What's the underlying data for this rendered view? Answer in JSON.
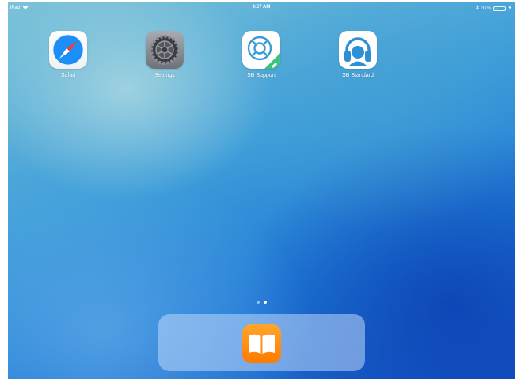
{
  "status_bar": {
    "device": "iPad",
    "time": "9:57 AM",
    "battery_text": "31%",
    "battery_level": 0.31,
    "wifi_icon": "wifi-icon",
    "bluetooth_icon": "bluetooth-icon",
    "charging_icon": "charging-bolt-icon"
  },
  "apps": [
    {
      "label": "Safari",
      "icon": "safari-compass-icon"
    },
    {
      "label": "Settings",
      "icon": "settings-gear-icon"
    },
    {
      "label": "SB Support",
      "icon": "lifebuoy-icon"
    },
    {
      "label": "SB Standard",
      "icon": "headphones-icon"
    }
  ],
  "page_indicator": {
    "pages": 2,
    "current": 2
  },
  "dock": {
    "apps": [
      {
        "label": "iBooks",
        "icon": "open-book-icon"
      }
    ]
  },
  "colors": {
    "battery_green": "#4cd964",
    "safari_blue": "#1c8ef5",
    "books_orange": "#ff8d0a",
    "support_green": "#3cc47c"
  }
}
